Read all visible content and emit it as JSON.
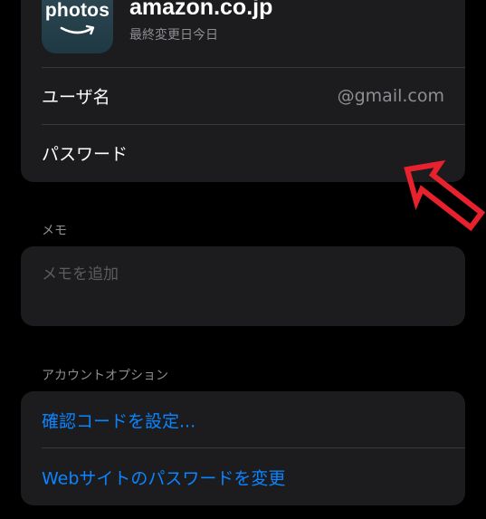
{
  "colors": {
    "background": "#000000",
    "card": "#1c1c1e",
    "separator": "#38383a",
    "secondary_text": "#8e8e93",
    "placeholder_text": "#5b5b60",
    "link": "#0a84ff",
    "annotation_arrow": "#e8212e"
  },
  "account": {
    "app_icon": {
      "icon_name": "amazon-photos-app-icon",
      "word": "photos"
    },
    "title": "amazon.co.jp",
    "subtitle": "最終変更日今日",
    "rows": [
      {
        "label": "ユーザ名",
        "value": "@gmail.com"
      },
      {
        "label": "パスワード",
        "value": ""
      }
    ]
  },
  "notes": {
    "header": "メモ",
    "placeholder": "メモを追加"
  },
  "account_options": {
    "header": "アカウントオプション",
    "items": [
      {
        "label": "確認コードを設定..."
      },
      {
        "label": "Webサイトのパスワードを変更"
      }
    ]
  },
  "annotation": {
    "icon_name": "red-outline-arrow-icon"
  }
}
